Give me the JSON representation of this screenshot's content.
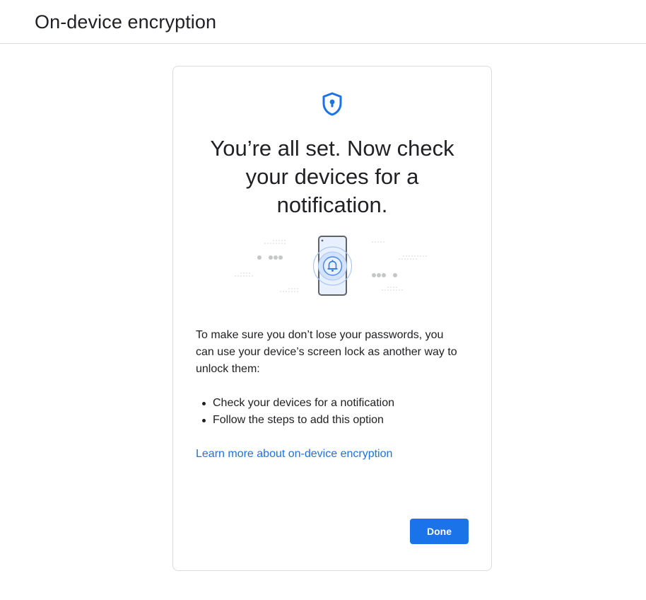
{
  "header": {
    "title": "On-device encryption"
  },
  "card": {
    "icon": "shield-lock-icon",
    "headline": "You’re all set. Now check your devices for a notification.",
    "illustration": "phone-notification-illustration",
    "body": "To make sure you don’t lose your passwords, you can use your device’s screen lock as another way to unlock them:",
    "bullets": [
      "Check your devices for a notification",
      "Follow the steps to add this option"
    ],
    "learn_more_link": "Learn more about on-device encryption",
    "done_label": "Done"
  },
  "colors": {
    "accent": "#1a73e8",
    "text": "#202124",
    "border": "#dadce0"
  }
}
